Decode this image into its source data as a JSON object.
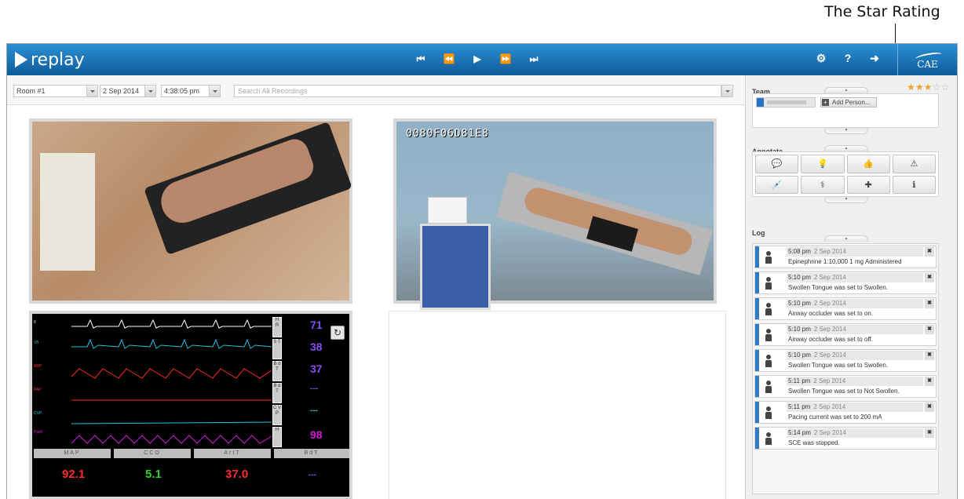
{
  "annotation_callout": "The Star Rating",
  "header": {
    "logo_text": "replay",
    "transport": [
      "skip-back-icon",
      "rewind-icon",
      "play-icon",
      "fast-forward-icon",
      "skip-forward-icon"
    ],
    "icons": [
      "gear-icon",
      "help-icon",
      "logout-icon"
    ],
    "brand": "CAE"
  },
  "filters": {
    "room": "Room #1",
    "date": "2 Sep 2014",
    "time": "4:38:05 pm",
    "search_placeholder": "Search All Recordings"
  },
  "video2": {
    "camera_label": "0080F06D81E8"
  },
  "monitor": {
    "left_scale": [
      "1.5",
      "0.5",
      "-0.5",
      "1.5",
      "0.5",
      "-0.5",
      "111.2",
      "111.2",
      "-0.2",
      "111.2",
      "12.4",
      "-12.4",
      "62.5",
      "13.3",
      "-12.7"
    ],
    "row_labels": [
      "II",
      "V5",
      "ABP",
      "PAP",
      "CVP",
      "Pleth"
    ],
    "side_buttons": [
      "H R",
      "S T",
      "B d T",
      "B d T",
      "C V P",
      "H"
    ],
    "values": [
      "71",
      "38",
      "37",
      "---",
      "---",
      "98"
    ],
    "value_colors": [
      "#8a4bf2",
      "#8a4bf2",
      "#8a4bf2",
      "#8a4bf2",
      "#20c7d6",
      "#d21ad6"
    ],
    "tabs": [
      "MAP",
      "CCO",
      "ArtT",
      "BdT"
    ],
    "bottom_values": [
      "92.1",
      "5.1",
      "37.0",
      "---"
    ],
    "bottom_colors": [
      "#ff2a2a",
      "#2bd42b",
      "#ff2a2a",
      "#8a4bf2"
    ]
  },
  "sidebar": {
    "rating": 3,
    "rating_max": 5,
    "team_title": "Team",
    "add_person": "Add Person...",
    "annotate_title": "Annotate",
    "annotate_icons": [
      "comment-icon",
      "lightbulb-icon",
      "thumbs-up-icon",
      "warning-icon",
      "syringe-icon",
      "stethoscope-icon",
      "medkit-icon",
      "info-icon"
    ],
    "log_title": "Log",
    "log": [
      {
        "time": "5:08 pm",
        "date": "2 Sep 2014",
        "message": "Epinephrine 1:10,000 1 mg Administered"
      },
      {
        "time": "5:10 pm",
        "date": "2 Sep 2014",
        "message": "Swollen Tongue was set to Swollen."
      },
      {
        "time": "5:10 pm",
        "date": "2 Sep 2014",
        "message": "Airway occluder was set to on."
      },
      {
        "time": "5:10 pm",
        "date": "2 Sep 2014",
        "message": "Airway occluder was set to off."
      },
      {
        "time": "5:10 pm",
        "date": "2 Sep 2014",
        "message": "Swollen Tongue was set to Swollen."
      },
      {
        "time": "5:11 pm",
        "date": "2 Sep 2014",
        "message": "Swollen Tongue was set to Not Swollen."
      },
      {
        "time": "5:11 pm",
        "date": "2 Sep 2014",
        "message": "Pacing current was set to 200 mA"
      },
      {
        "time": "5:14 pm",
        "date": "2 Sep 2014",
        "message": "SCE was stopped."
      }
    ]
  }
}
